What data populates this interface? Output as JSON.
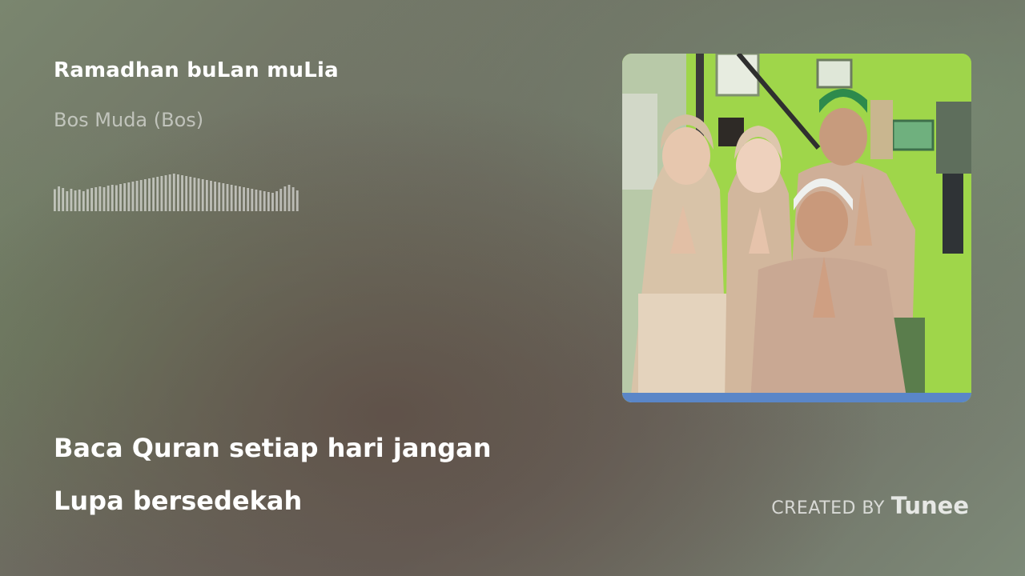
{
  "track": {
    "title": "Ramadhan buLan muLia",
    "artist": "Bos Muda (Bos)"
  },
  "lyrics": {
    "line1": "Baca Quran setiap hari jangan",
    "line2": "Lupa bersedekah"
  },
  "credit": {
    "prefix": "CREATED BY",
    "brand": "Tunee"
  },
  "waveform": {
    "levels": [
      0.55,
      0.62,
      0.58,
      0.5,
      0.56,
      0.52,
      0.54,
      0.5,
      0.55,
      0.58,
      0.6,
      0.62,
      0.6,
      0.64,
      0.66,
      0.65,
      0.68,
      0.7,
      0.72,
      0.74,
      0.76,
      0.78,
      0.8,
      0.82,
      0.84,
      0.86,
      0.88,
      0.9,
      0.92,
      0.94,
      0.92,
      0.9,
      0.88,
      0.86,
      0.84,
      0.82,
      0.8,
      0.78,
      0.76,
      0.74,
      0.72,
      0.7,
      0.68,
      0.66,
      0.64,
      0.62,
      0.6,
      0.58,
      0.56,
      0.54,
      0.52,
      0.5,
      0.48,
      0.46,
      0.5,
      0.56,
      0.62,
      0.66,
      0.6,
      0.52
    ]
  },
  "cover": {
    "icon": "album-cover-image",
    "wall_color": "#9fd64a"
  }
}
